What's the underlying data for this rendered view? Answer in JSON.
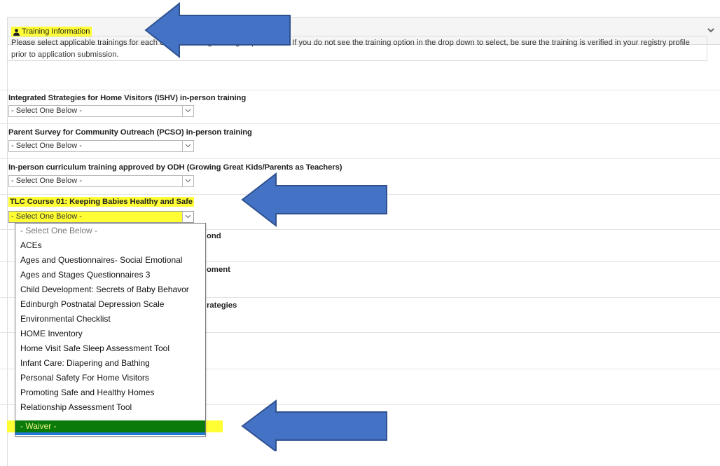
{
  "header": {
    "title": "Training Information"
  },
  "intro_text": "Please select applicable trainings for each of the following training requirements. If you do not see the training option in the drop down to select, be sure the training is verified in your registry profile prior to application submission.",
  "fields": [
    {
      "label": "Integrated Strategies for Home Visitors (ISHV) in-person training",
      "value": "- Select One Below -"
    },
    {
      "label": "Parent Survey for Community Outreach (PCSO) in-person training",
      "value": "- Select One Below -"
    },
    {
      "label": "In-person curriculum training approved by ODH (Growing Great Kids/Parents as Teachers)",
      "value": "- Select One Below -"
    },
    {
      "label": "TLC Course 01: Keeping Babies Healthy and Safe",
      "value": "- Select One Below -"
    }
  ],
  "hidden_label_fragments": [
    "ond",
    "oment",
    "rategies"
  ],
  "dropdown": {
    "options": [
      "- Select One Below -",
      "ACEs",
      "Ages and Questionnaires- Social Emotional",
      "Ages and Stages Questionnaires 3",
      "Child Development: Secrets of Baby Behavor",
      "Edinburgh Postnatal Depression Scale",
      "Environmental Checklist",
      "HOME Inventory",
      "Home Visit Safe Sleep Assessment Tool",
      "Infant Care: Diapering and Bathing",
      "Personal Safety For Home Visitors",
      "Promoting Safe and Healthy Homes",
      "Relationship Assessment Tool",
      "- Waiver -"
    ],
    "selected": "- Waiver -"
  },
  "colors": {
    "highlight": "#ffff33",
    "arrow": "#4472c4",
    "selected_bg": "#0a7a0a"
  }
}
